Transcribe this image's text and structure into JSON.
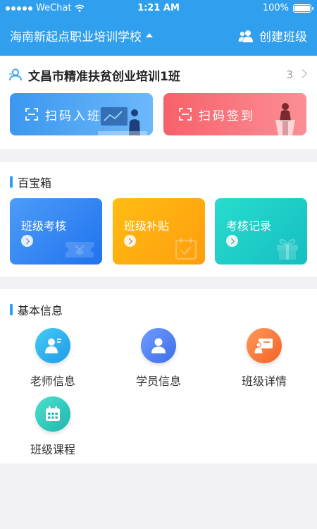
{
  "status_bar": {
    "carrier": "WeChat",
    "time": "1:21 AM",
    "battery": "100%",
    "battery_level": 1.0
  },
  "header": {
    "school_name": "海南新起点职业培训学校",
    "create_class_label": "创建班级"
  },
  "current_class": {
    "name": "文昌市精准扶贫创业培训1班",
    "count": "3"
  },
  "actions": {
    "scan_join_label": "扫码入班",
    "scan_sign_label": "扫码签到"
  },
  "toolbox": {
    "title": "百宝箱",
    "cards": [
      {
        "label": "班级考核"
      },
      {
        "label": "班级补贴"
      },
      {
        "label": "考核记录"
      }
    ]
  },
  "basic_info": {
    "title": "基本信息",
    "items": [
      {
        "label": "老师信息"
      },
      {
        "label": "学员信息"
      },
      {
        "label": "班级详情"
      },
      {
        "label": "班级课程"
      }
    ]
  },
  "colors": {
    "primary": "#2f9fee",
    "danger": "#f7616a",
    "orange": "#ffad10",
    "teal": "#1fc9c6"
  }
}
